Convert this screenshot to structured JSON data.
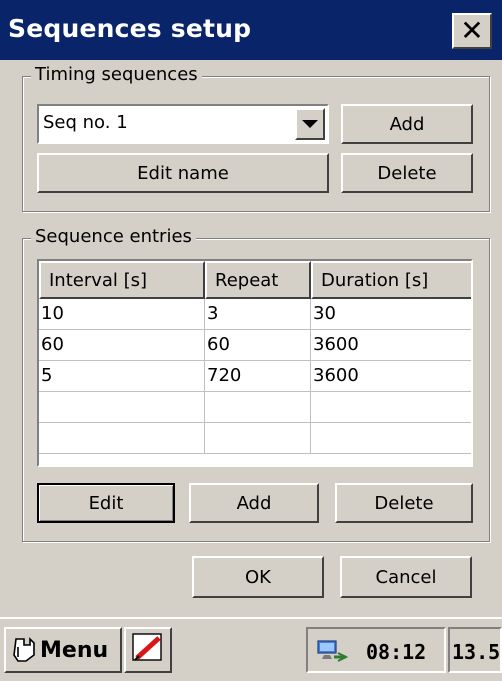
{
  "window": {
    "title": "Sequences setup",
    "close_icon": "close-icon"
  },
  "timing_sequences": {
    "legend": "Timing sequences",
    "selected_sequence": "Seq no. 1",
    "add_label": "Add",
    "edit_name_label": "Edit name",
    "delete_label": "Delete"
  },
  "sequence_entries": {
    "legend": "Sequence entries",
    "columns": [
      "Interval [s]",
      "Repeat",
      "Duration [s]"
    ],
    "rows": [
      [
        "10",
        "3",
        "30"
      ],
      [
        "60",
        "60",
        "3600"
      ],
      [
        "5",
        "720",
        "3600"
      ],
      [
        "",
        "",
        ""
      ],
      [
        "",
        "",
        ""
      ]
    ],
    "edit_label": "Edit",
    "add_label": "Add",
    "delete_label": "Delete"
  },
  "dialog": {
    "ok_label": "OK",
    "cancel_label": "Cancel"
  },
  "taskbar": {
    "menu_label": "Menu",
    "clock": "08:12",
    "extra": "13.5",
    "icons": [
      "start-icon",
      "pen-icon",
      "network-icon"
    ]
  },
  "colors": {
    "titlebar": "#0a246a",
    "face": "#d4d0c8"
  }
}
